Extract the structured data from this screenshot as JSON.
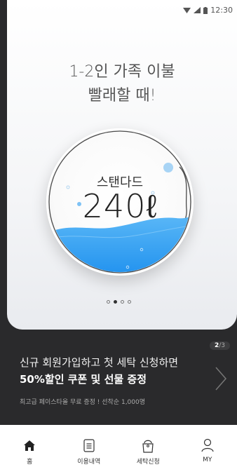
{
  "status_bar": {
    "time": "12:30",
    "icons": [
      "wifi-icon",
      "signal-icon",
      "battery-icon"
    ]
  },
  "hero": {
    "headline_line1": "1-2인 가족 이불",
    "headline_line2": "빨래할 때!",
    "dial_label": "스탠다드",
    "dial_value": "240ℓ",
    "water_color": "#2a9df4",
    "bubble_color": "#a8d4f5",
    "pager": {
      "count": 4,
      "active_index": 1
    }
  },
  "promo": {
    "counter_current": "2",
    "counter_total": "/3",
    "line1": "신규 회원가입하고 첫 세탁 신청하면",
    "line2": "50%할인 쿠폰 및 선물 증정",
    "subtext": "최고급 페이스타올 무료 증정 ! 선착순 1,000명",
    "next_icon": "chevron-right-icon"
  },
  "tabbar": {
    "items": [
      {
        "label": "홈",
        "icon": "home-icon"
      },
      {
        "label": "이용내역",
        "icon": "list-icon"
      },
      {
        "label": "세탁신청",
        "icon": "laundry-bag-icon"
      },
      {
        "label": "MY",
        "icon": "user-icon"
      }
    ]
  },
  "colors": {
    "background_dark": "#2a2a2c",
    "accent_water": "#2a9df4"
  }
}
